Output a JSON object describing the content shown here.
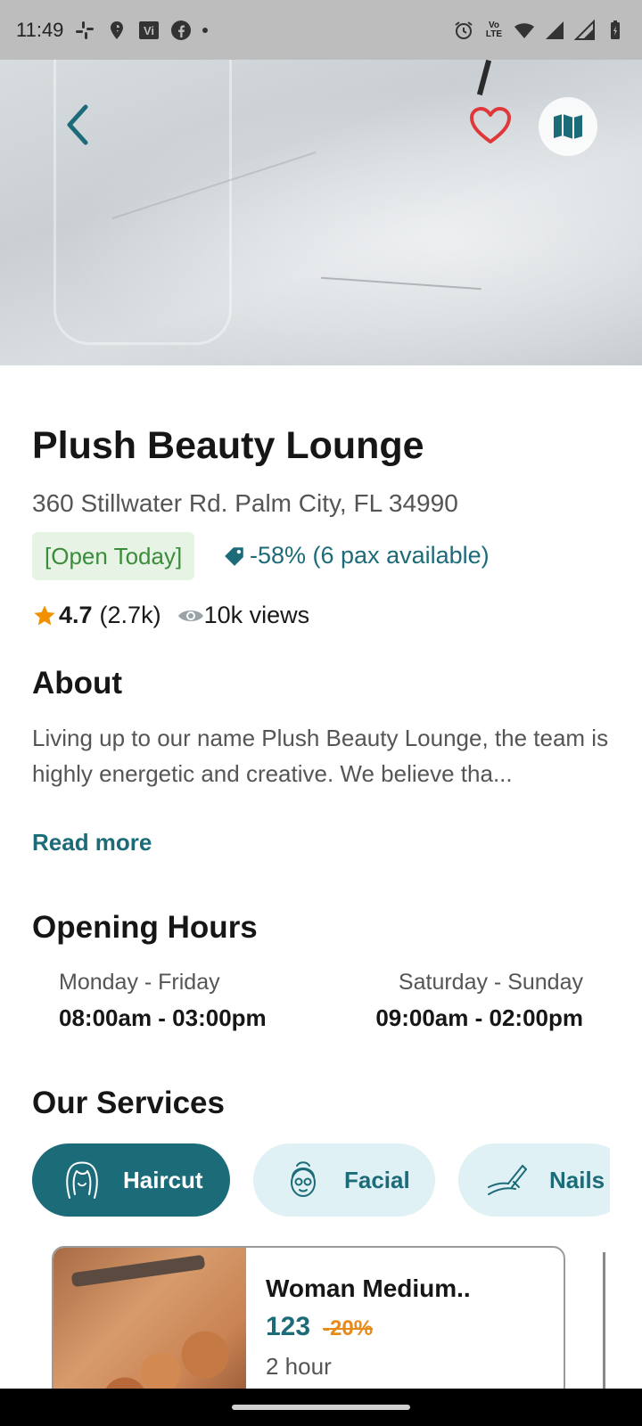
{
  "status_bar": {
    "time": "11:49",
    "volte_label_top": "Vo",
    "volte_label_bottom": "LTE"
  },
  "hero": {
    "back_icon": "chevron-left-icon",
    "favorite_icon": "heart-outline-icon",
    "map_icon": "map-icon"
  },
  "venue": {
    "name": "Plush Beauty Lounge",
    "address": "360 Stillwater Rd. Palm City, FL 34990",
    "open_badge": "[Open Today]",
    "discount": "-58% (6 pax available)",
    "rating": "4.7",
    "rating_count": "(2.7k)",
    "views": "10k views"
  },
  "about": {
    "title": "About",
    "text": "Living up to our name Plush Beauty Lounge, the team is highly energetic and creative. We believe tha...",
    "read_more": "Read more"
  },
  "hours": {
    "title": "Opening Hours",
    "weekday_days": "Monday - Friday",
    "weekday_time": "08:00am - 03:00pm",
    "weekend_days": "Saturday - Sunday",
    "weekend_time": "09:00am - 02:00pm"
  },
  "services": {
    "title": "Our Services",
    "chips": [
      {
        "label": "Haircut",
        "icon": "haircut-icon",
        "active": true
      },
      {
        "label": "Facial",
        "icon": "facial-icon",
        "active": false
      },
      {
        "label": "Nails",
        "icon": "nail-polish-icon",
        "active": false
      }
    ],
    "card": {
      "title": "Woman Medium..",
      "price": "123",
      "discount": "-20%",
      "duration": "2 hour"
    }
  },
  "colors": {
    "accent": "#1c6b78",
    "open_bg": "#e6f3e5",
    "open_text": "#3b8d3b",
    "star": "#f29100",
    "discount_orange": "#e88a1a",
    "heart": "#e0383a"
  }
}
